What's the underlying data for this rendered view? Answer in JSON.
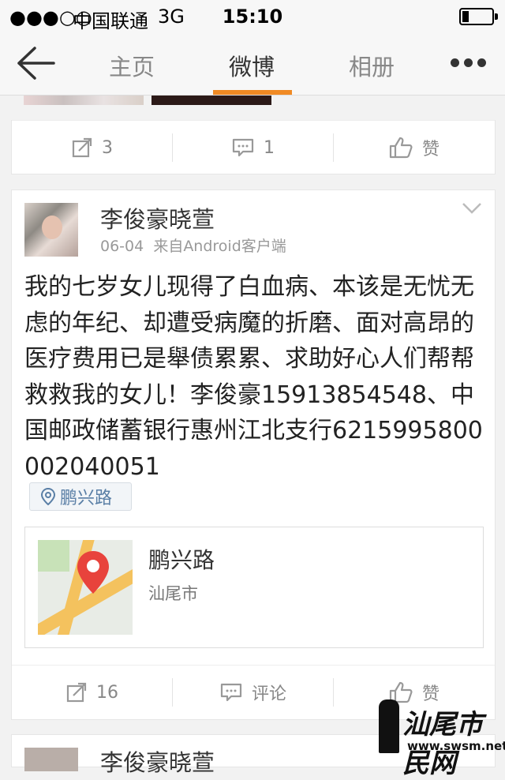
{
  "status_bar": {
    "signal": "●●●○○",
    "carrier": "中国联通",
    "network": "3G",
    "time": "15:10"
  },
  "nav": {
    "tabs": [
      {
        "label": "主页",
        "active": false
      },
      {
        "label": "微博",
        "active": true
      },
      {
        "label": "相册",
        "active": false
      }
    ],
    "accent_color": "#f08a24"
  },
  "prev_post": {
    "repost_count": "3",
    "comment_count": "1",
    "like_label": "赞"
  },
  "post": {
    "username": "李俊豪晓萱",
    "date": "06-04",
    "source": "来自Android客户端",
    "content": "我的七岁女儿现得了白血病、本该是无忧无虑的年纪、却遭受病魔的折磨、面对高昂的医疗费用已是舉债累累、求助好心人们帮帮救救我的女儿！李俊豪15913854548、中国邮政储蓄银行惠州江北支行6215995800002040051",
    "location_tag": "鹏兴路",
    "location_card": {
      "name": "鹏兴路",
      "city": "汕尾市"
    },
    "repost_count": "16",
    "comment_label": "评论",
    "like_label": "赞"
  },
  "next_post": {
    "username": "李俊豪晓萱"
  },
  "watermark": {
    "title": "汕尾市民网",
    "url": "www.swsm.net"
  }
}
